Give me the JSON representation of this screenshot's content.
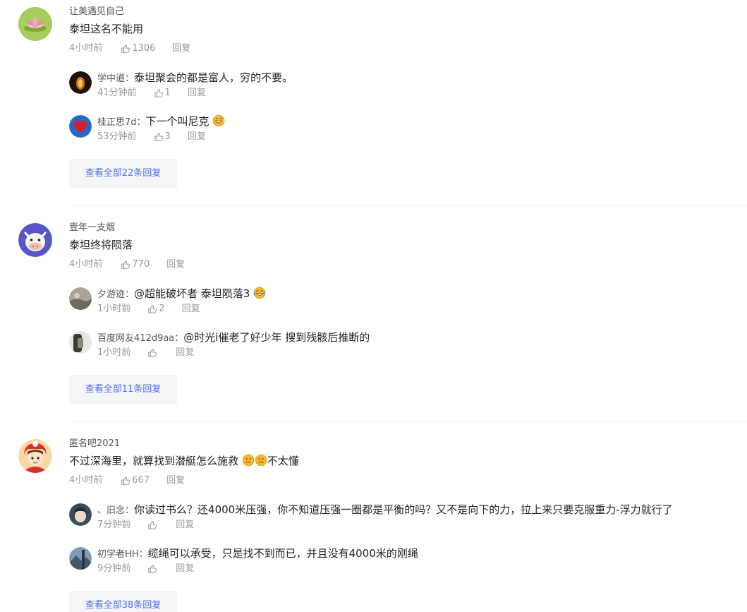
{
  "threads": [
    {
      "author": "让美遇见自己",
      "text": "泰坦这名不能用",
      "time": "4小时前",
      "likes": "1306",
      "reply_label": "回复",
      "replies": [
        {
          "name": "学中道",
          "sep": "：",
          "text": "泰坦聚会的都是富人，穷的不要。",
          "time": "41分钟前",
          "likes": "1",
          "reply_label": "回复"
        },
        {
          "name": "桂正思7d",
          "sep": "：",
          "text": "下一个叫尼克",
          "emoji": "grinning-sweat",
          "time": "53分钟前",
          "likes": "3",
          "reply_label": "回复"
        }
      ],
      "more": "查看全部22条回复"
    },
    {
      "author": "壹年一支烟",
      "text": "泰坦终将陨落",
      "time": "4小时前",
      "likes": "770",
      "reply_label": "回复",
      "replies": [
        {
          "name": "夕游迹",
          "sep": "：",
          "text": "@超能破坏者 泰坦陨落3",
          "emoji": "tears-of-joy",
          "time": "1小时前",
          "likes": "2",
          "reply_label": "回复"
        },
        {
          "name": "百度网友412d9aa",
          "sep": "：",
          "text": "@时光i催老了好少年 搜到残骸后推断的",
          "time": "1小时前",
          "likes": "",
          "reply_label": "回复"
        }
      ],
      "more": "查看全部11条回复"
    },
    {
      "author": "匿名吧2021",
      "text": "不过深海里，就算找到潜艇怎么施救",
      "text_tail": "不太懂",
      "time": "4小时前",
      "likes": "667",
      "reply_label": "回复",
      "replies": [
        {
          "name": "、旧念",
          "sep": "：",
          "text": "你读过书么？还4000米压强，你不知道压强一圈都是平衡的吗？又不是向下的力，拉上来只要克服重力-浮力就行了",
          "time": "7分钟前",
          "likes": "",
          "reply_label": "回复"
        },
        {
          "name": "初学者HH",
          "sep": "：",
          "text": "缆绳可以承受，只是找不到而已，并且没有4000米的刚绳",
          "time": "9分钟前",
          "likes": "",
          "reply_label": "回复"
        }
      ],
      "more": "查看全部38条回复"
    }
  ],
  "colors": {
    "link": "#4e6ef2",
    "meta": "#999999",
    "more_bg": "#f4f5f7"
  }
}
